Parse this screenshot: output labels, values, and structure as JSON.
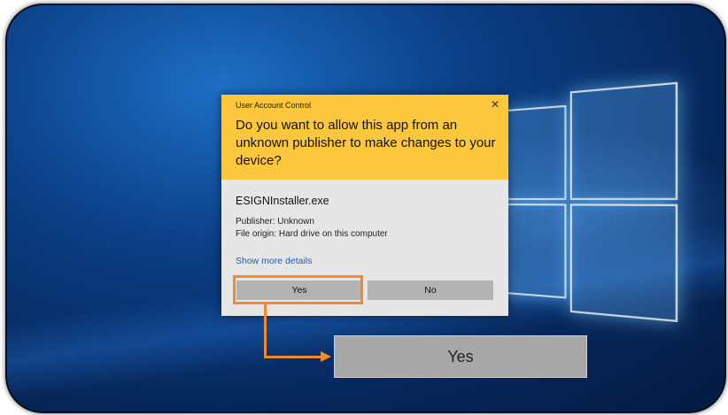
{
  "dialog": {
    "title": "User Account Control",
    "close_glyph": "✕",
    "question": "Do you want to allow this app from an unknown publisher to make changes to your device?",
    "app_name": "ESIGNInstaller.exe",
    "publisher": "Publisher: Unknown",
    "file_origin": "File origin: Hard drive on this computer",
    "more_details": "Show more details",
    "yes_label": "Yes",
    "no_label": "No",
    "header_color": "#fcc73c"
  },
  "callout": {
    "zoomed_label": "Yes",
    "highlight_color": "#f08a2c"
  }
}
